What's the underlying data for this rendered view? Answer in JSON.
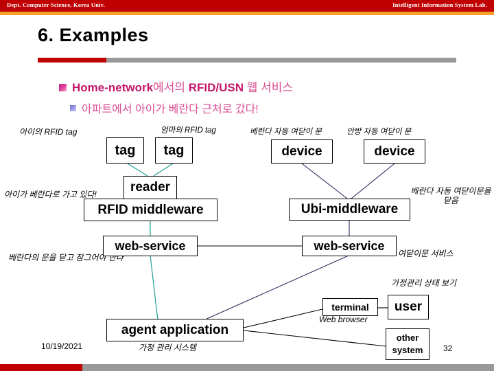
{
  "header": {
    "left": "Dept. Computer Science, Korea Univ.",
    "right": "Intelligent Information System Lab.",
    "bar_color": "#c00000",
    "accent_color": "#f7a227"
  },
  "title": {
    "text": "6. Examples",
    "rule_red": "#c00000",
    "rule_gray": "#999999"
  },
  "bullets": {
    "level1": {
      "part_en1": "Home-network",
      "part_kr1": "에서의 ",
      "part_en2": "RFID/USN",
      "part_kr2": " 웹 서비스"
    },
    "level2": "아파트에서 아이가 베란다 근처로 갔다!"
  },
  "diagram": {
    "nodes": {
      "tag_child": "tag",
      "tag_mother": "tag",
      "reader": "reader",
      "rfid_middleware": "RFID middleware",
      "web_service_left": "web-service",
      "agent_application": "agent application",
      "device_veranda": "device",
      "device_bedroom": "device",
      "ubi_middleware": "Ubi-middleware",
      "web_service_right": "web-service",
      "terminal": "terminal",
      "user": "user",
      "other_system_line1": "other",
      "other_system_line2": "system"
    },
    "labels": {
      "tag_child": "아이의 RFID tag",
      "tag_mother": "엄마의 RFID tag",
      "device_veranda": "베란다 자동 여닫이 문",
      "device_bedroom": "안방 자동 여닫이 문",
      "reader_note": "아이가 베란다로 가고 있다!",
      "ubi_note": "베란다 자동 여닫이문을 닫음",
      "web_service_left_note": "베란다의 문을 닫고 잠그어야 한다",
      "web_service_right_note": "여닫이문 서비스",
      "user_note": "가정관리 상태 보기",
      "terminal_note": "Web browser",
      "agent_note": "가정 관리 시스템"
    },
    "link_color_teal": "#1f9e94",
    "link_color_navy": "#2b2b5e",
    "link_color_black": "#000000"
  },
  "footer": {
    "date": "10/19/2021",
    "page": "32"
  }
}
